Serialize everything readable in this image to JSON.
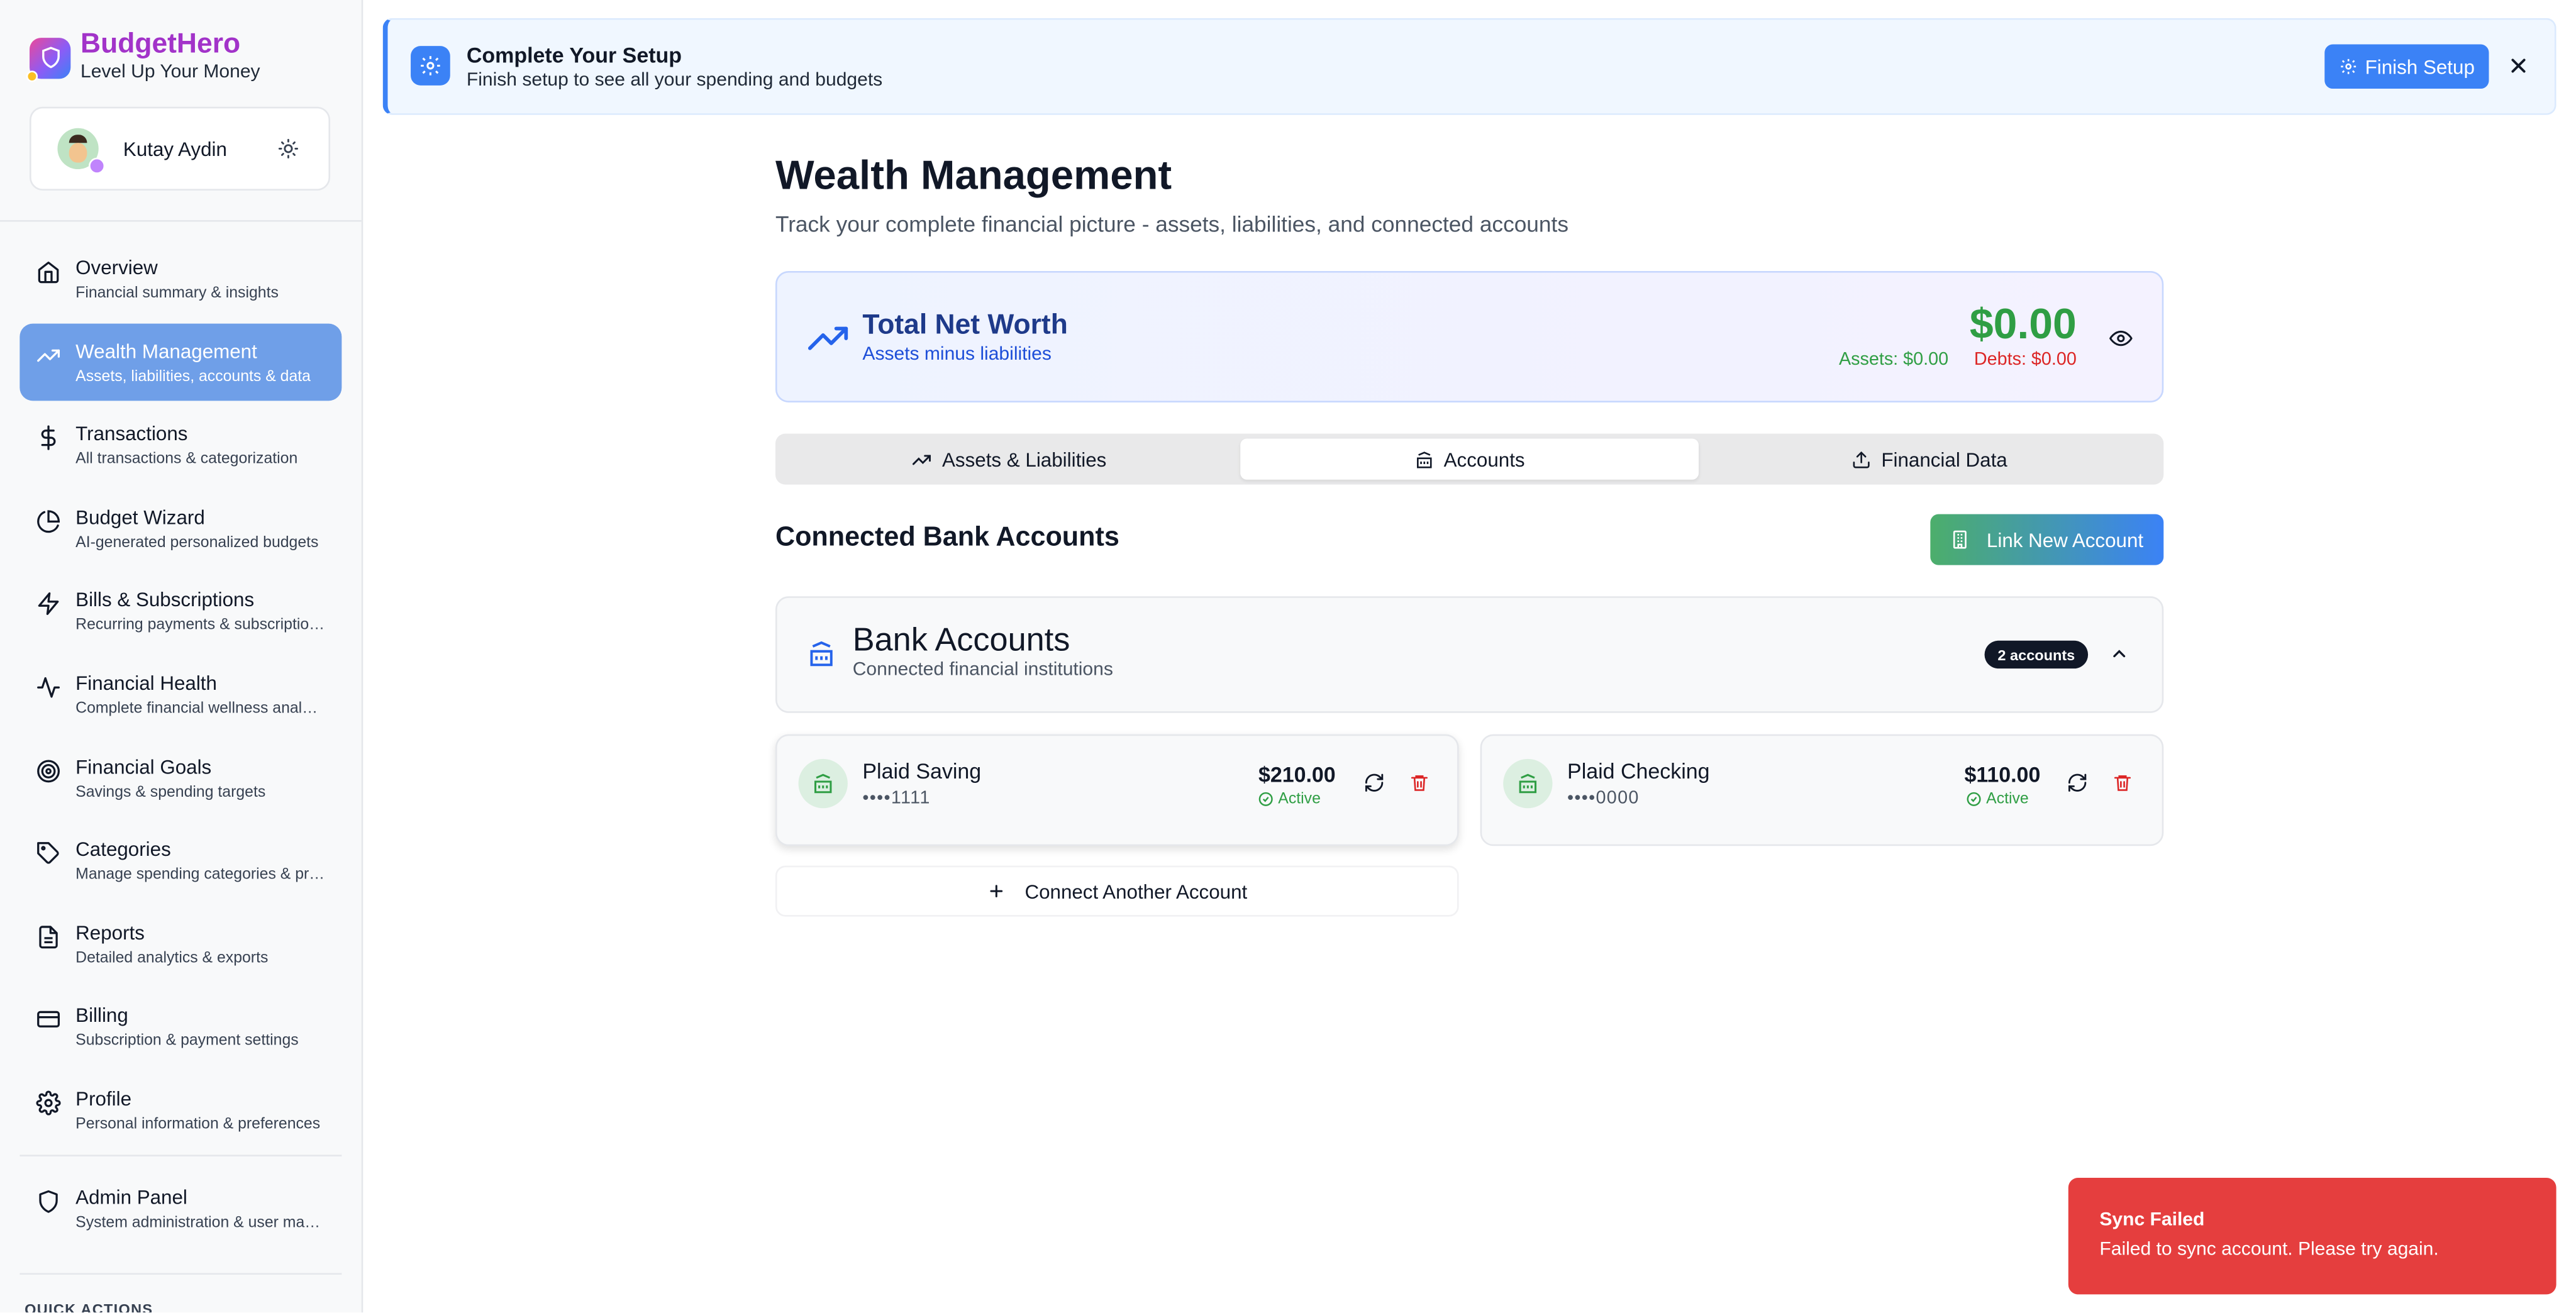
{
  "app": {
    "name": "BudgetHero",
    "tagline": "Level Up Your Money",
    "brand_color": "#a233c9",
    "accent": "#3b82f6"
  },
  "user": {
    "name": "Kutay Aydin",
    "theme_icon": "sun-icon"
  },
  "sidebar": {
    "items": [
      {
        "label": "Overview",
        "sub": "Financial summary & insights",
        "icon": "home-icon",
        "active": false
      },
      {
        "label": "Wealth Management",
        "sub": "Assets, liabilities, accounts & data",
        "icon": "trending-up-icon",
        "active": true
      },
      {
        "label": "Transactions",
        "sub": "All transactions & categorization",
        "icon": "dollar-icon",
        "active": false
      },
      {
        "label": "Budget Wizard",
        "sub": "AI-generated personalized budgets",
        "icon": "pie-chart-icon",
        "active": false
      },
      {
        "label": "Bills & Subscriptions",
        "sub": "Recurring payments & subscriptions",
        "icon": "zap-icon",
        "active": false
      },
      {
        "label": "Financial Health",
        "sub": "Complete financial wellness analysis",
        "icon": "activity-icon",
        "active": false
      },
      {
        "label": "Financial Goals",
        "sub": "Savings & spending targets",
        "icon": "target-icon",
        "active": false
      },
      {
        "label": "Categories",
        "sub": "Manage spending categories & preferences",
        "icon": "tag-icon",
        "active": false
      },
      {
        "label": "Reports",
        "sub": "Detailed analytics & exports",
        "icon": "file-text-icon",
        "active": false
      },
      {
        "label": "Billing",
        "sub": "Subscription & payment settings",
        "icon": "credit-card-icon",
        "active": false
      },
      {
        "label": "Profile",
        "sub": "Personal information & preferences",
        "icon": "settings-icon",
        "active": false
      }
    ],
    "admin": {
      "label": "Admin Panel",
      "sub": "System administration & user management",
      "icon": "shield-icon"
    },
    "quick_actions_label": "QUICK ACTIONS"
  },
  "banner": {
    "title": "Complete Your Setup",
    "subtitle": "Finish setup to see all your spending and budgets",
    "button": "Finish Setup"
  },
  "page": {
    "title": "Wealth Management",
    "subtitle": "Track your complete financial picture - assets, liabilities, and connected accounts"
  },
  "net_worth": {
    "title": "Total Net Worth",
    "subtitle": "Assets minus liabilities",
    "value": "$0.00",
    "assets": "Assets: $0.00",
    "debts": "Debts: $0.00",
    "positive_color": "#2f9e44",
    "negative_color": "#dc2626"
  },
  "tabs": [
    {
      "label": "Assets & Liabilities",
      "icon": "trending-up-icon",
      "active": false
    },
    {
      "label": "Accounts",
      "icon": "bank-icon",
      "active": true
    },
    {
      "label": "Financial Data",
      "icon": "upload-icon",
      "active": false
    }
  ],
  "connected": {
    "title": "Connected Bank Accounts",
    "link_button": "Link New Account",
    "panel_title": "Bank Accounts",
    "panel_sub": "Connected financial institutions",
    "badge": "2 accounts",
    "accounts": [
      {
        "name": "Plaid Saving",
        "mask": "••••1111",
        "balance": "$210.00",
        "status": "Active"
      },
      {
        "name": "Plaid Checking",
        "mask": "••••0000",
        "balance": "$110.00",
        "status": "Active"
      }
    ],
    "connect_more": "Connect Another Account"
  },
  "toast": {
    "title": "Sync Failed",
    "message": "Failed to sync account. Please try again.",
    "color": "#e53e3e"
  }
}
